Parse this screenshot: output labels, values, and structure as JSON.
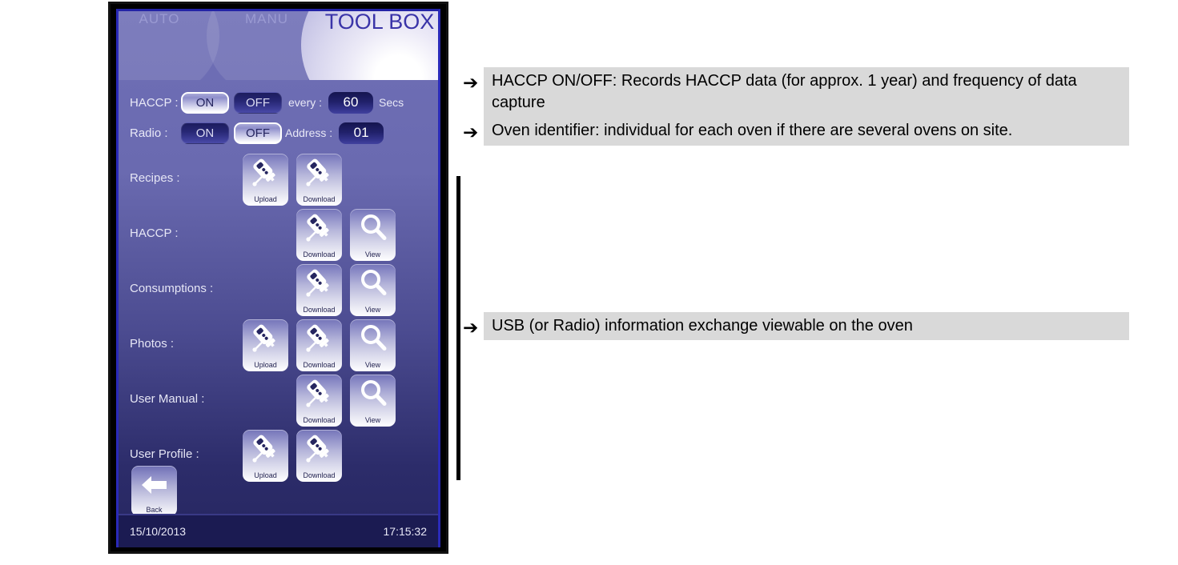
{
  "device": {
    "header": {
      "tabs": [
        {
          "id": "auto",
          "label": "AUTO",
          "state": "inactive"
        },
        {
          "id": "manu",
          "label": "MANU",
          "state": "inactive"
        },
        {
          "id": "toolbox",
          "label": "TOOL BOX",
          "state": "active"
        }
      ]
    },
    "settings": {
      "haccp": {
        "label": "HACCP :",
        "on_label": "ON",
        "off_label": "OFF",
        "selected": "ON",
        "every_label": "every :",
        "interval_value": "60",
        "interval_unit": "Secs"
      },
      "radio": {
        "label": "Radio :",
        "on_label": "ON",
        "off_label": "OFF",
        "selected": "OFF",
        "address_label": "Address :",
        "address_value": "01"
      }
    },
    "action_rows": [
      {
        "label": "Recipes :",
        "buttons": [
          {
            "slot": 1,
            "caption": "Upload",
            "icon": "usb-stick-icon"
          },
          {
            "slot": 2,
            "caption": "Download",
            "icon": "usb-stick-icon"
          },
          {
            "slot": 3,
            "caption": null,
            "icon": null
          }
        ]
      },
      {
        "label": "HACCP :",
        "buttons": [
          {
            "slot": 1,
            "caption": null,
            "icon": null
          },
          {
            "slot": 2,
            "caption": "Download",
            "icon": "usb-stick-icon"
          },
          {
            "slot": 3,
            "caption": "View",
            "icon": "magnifier-icon"
          }
        ]
      },
      {
        "label": "Consumptions :",
        "buttons": [
          {
            "slot": 1,
            "caption": null,
            "icon": null
          },
          {
            "slot": 2,
            "caption": "Download",
            "icon": "usb-stick-icon"
          },
          {
            "slot": 3,
            "caption": "View",
            "icon": "magnifier-icon"
          }
        ]
      },
      {
        "label": "Photos :",
        "buttons": [
          {
            "slot": 1,
            "caption": "Upload",
            "icon": "usb-stick-icon"
          },
          {
            "slot": 2,
            "caption": "Download",
            "icon": "usb-stick-icon"
          },
          {
            "slot": 3,
            "caption": "View",
            "icon": "magnifier-icon"
          }
        ]
      },
      {
        "label": "User Manual :",
        "buttons": [
          {
            "slot": 1,
            "caption": null,
            "icon": null
          },
          {
            "slot": 2,
            "caption": "Download",
            "icon": "usb-stick-icon"
          },
          {
            "slot": 3,
            "caption": "View",
            "icon": "magnifier-icon"
          }
        ]
      },
      {
        "label": "User Profile :",
        "buttons": [
          {
            "slot": 1,
            "caption": "Upload",
            "icon": "usb-stick-icon"
          },
          {
            "slot": 2,
            "caption": "Download",
            "icon": "usb-stick-icon"
          },
          {
            "slot": 3,
            "caption": null,
            "icon": null
          }
        ]
      }
    ],
    "back_button": {
      "caption": "Back",
      "icon": "left-arrow-icon"
    },
    "status_bar": {
      "date": "15/10/2013",
      "time": "17:15:32"
    }
  },
  "annotations": [
    {
      "arrow": "➔",
      "text": "HACCP ON/OFF: Records HACCP data (for approx. 1 year) and frequency of data capture"
    },
    {
      "arrow": "➔",
      "text": "Oven identifier: individual for each oven if there are several ovens on site."
    },
    {
      "arrow": "➔",
      "text": "USB (or Radio) information exchange viewable on the oven"
    }
  ],
  "colors": {
    "screen_top": "#6f6fb6",
    "screen_bottom": "#262660",
    "frame": "#000000",
    "toolbox_title": "#3a34a8",
    "annotation_background": "#d9d9d9",
    "status_bar": "#1b1b52",
    "bracket": "#000000"
  }
}
